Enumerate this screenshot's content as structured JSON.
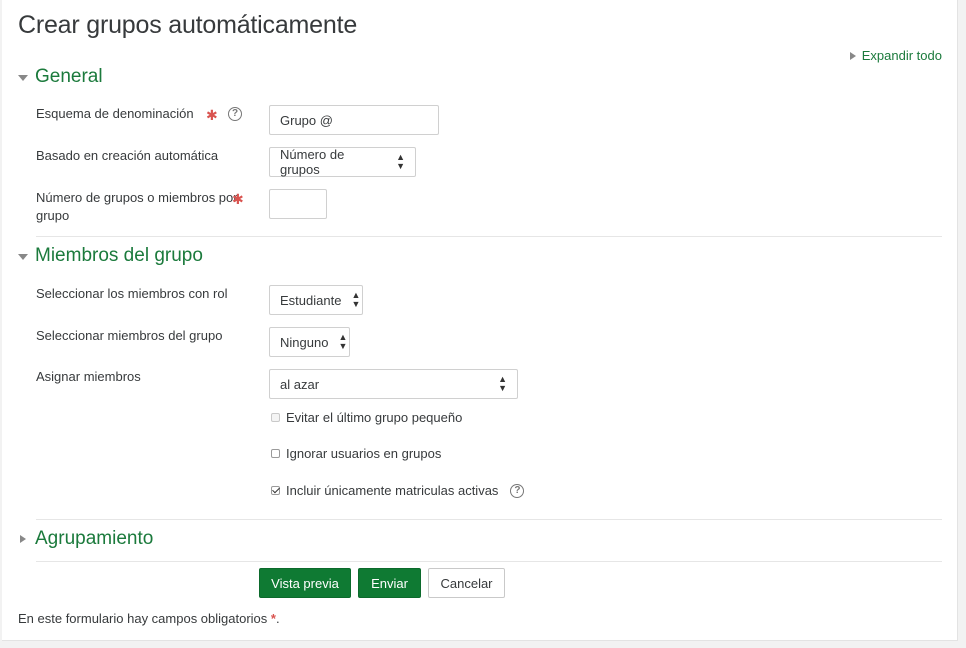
{
  "page": {
    "title": "Crear grupos automáticamente",
    "expand_all": "Expandir todo",
    "required_note": "En este formulario hay campos obligatorios",
    "required_star": "*",
    "required_note_end": "."
  },
  "sections": {
    "general": {
      "title": "General",
      "naming_label": "Esquema de denominación",
      "naming_value": "Grupo @",
      "based_on_label": "Basado en creación automática",
      "based_on_value": "Número de grupos",
      "number_label_line1": "Número de grupos o miembros por",
      "number_label_line2": "grupo",
      "number_value": ""
    },
    "members": {
      "title": "Miembros del grupo",
      "role_label": "Seleccionar los miembros con rol",
      "role_value": "Estudiante",
      "group_label": "Seleccionar miembros del grupo",
      "group_value": "Ninguno",
      "allocate_label": "Asignar miembros",
      "allocate_value": "al azar",
      "options": [
        {
          "label": "Evitar el último grupo pequeño",
          "checked": false,
          "disabled": true
        },
        {
          "label": "Ignorar usuarios en grupos",
          "checked": false,
          "disabled": false
        },
        {
          "label": "Incluir únicamente matriculas activas",
          "checked": true,
          "disabled": false
        }
      ]
    },
    "grouping": {
      "title": "Agrupamiento"
    }
  },
  "buttons": {
    "preview": "Vista previa",
    "submit": "Enviar",
    "cancel": "Cancelar"
  },
  "icons": {
    "required": "required-asterisk-icon",
    "help": "help-question-icon",
    "expand": "caret-right-icon",
    "collapse": "caret-down-icon",
    "select": "up-down-arrows-icon"
  },
  "colors": {
    "accent": "#1b7a3c",
    "primary_button": "#0f7a33",
    "required": "#d9534f"
  }
}
